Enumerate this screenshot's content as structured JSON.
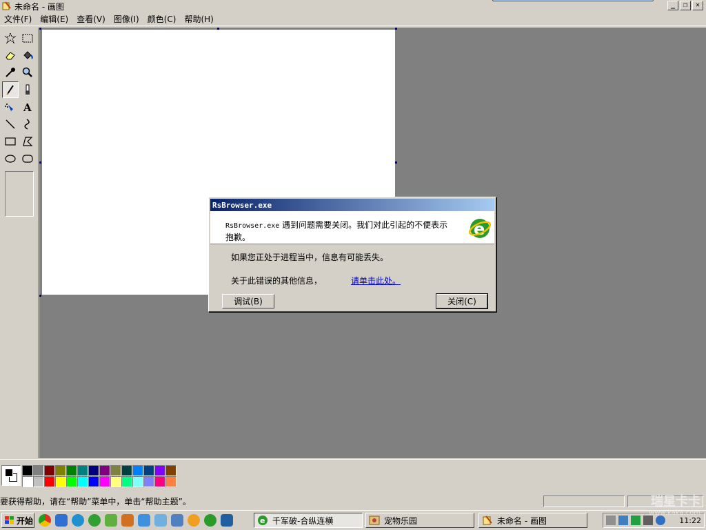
{
  "window": {
    "title": "未命名 - 画图"
  },
  "menu": [
    {
      "label": "文件(F)"
    },
    {
      "label": "编辑(E)"
    },
    {
      "label": "查看(V)"
    },
    {
      "label": "图像(I)"
    },
    {
      "label": "颜色(C)"
    },
    {
      "label": "帮助(H)"
    }
  ],
  "tools": [
    {
      "name": "free-select",
      "icon": "star-select-icon"
    },
    {
      "name": "rect-select",
      "icon": "rect-select-icon"
    },
    {
      "name": "eraser",
      "icon": "eraser-icon"
    },
    {
      "name": "fill",
      "icon": "fill-bucket-icon"
    },
    {
      "name": "pick-color",
      "icon": "eyedropper-icon"
    },
    {
      "name": "magnifier",
      "icon": "magnifier-icon"
    },
    {
      "name": "pencil",
      "icon": "pencil-icon",
      "active": true
    },
    {
      "name": "brush",
      "icon": "brush-icon"
    },
    {
      "name": "airbrush",
      "icon": "airbrush-icon"
    },
    {
      "name": "text",
      "icon": "text-icon"
    },
    {
      "name": "line",
      "icon": "line-icon"
    },
    {
      "name": "curve",
      "icon": "curve-icon"
    },
    {
      "name": "rectangle",
      "icon": "rectangle-icon"
    },
    {
      "name": "polygon",
      "icon": "polygon-icon"
    },
    {
      "name": "ellipse",
      "icon": "ellipse-icon"
    },
    {
      "name": "rounded-rect",
      "icon": "rounded-rect-icon"
    }
  ],
  "palette": {
    "foreground": "#000000",
    "background": "#ffffff",
    "colors": [
      "#000000",
      "#808080",
      "#800000",
      "#808000",
      "#008000",
      "#008080",
      "#000080",
      "#800080",
      "#808040",
      "#004040",
      "#0080ff",
      "#004080",
      "#8000ff",
      "#804000",
      "#ffffff",
      "#c0c0c0",
      "#ff0000",
      "#ffff00",
      "#00ff00",
      "#00ffff",
      "#0000ff",
      "#ff00ff",
      "#ffff80",
      "#00ff80",
      "#80ffff",
      "#8080ff",
      "#ff0080",
      "#ff8040"
    ]
  },
  "status": {
    "text": "要获得帮助，请在“帮助”菜单中，单击“帮助主题”。"
  },
  "taskbar": {
    "start_label": "开始",
    "tasks": [
      {
        "label": "千军破-合纵连横",
        "icon": "ie-icon",
        "pressed": true
      },
      {
        "label": "宠物乐园",
        "icon": "pet-icon",
        "pressed": false
      },
      {
        "label": "未命名 - 画图",
        "icon": "paint-icon",
        "pressed": false
      }
    ],
    "clock": "11:22"
  },
  "watermark": {
    "brand": "瑞星卡卡",
    "url": "www.kaka.com"
  },
  "dialog": {
    "title": "RsBrowser.exe",
    "exe_name": "RsBrowser.exe",
    "message": " 遇到问题需要关闭。我们对此引起的不便表示抱歉。",
    "line1": "如果您正处于进程当中，信息有可能丢失。",
    "line2": "关于此错误的其他信息，",
    "link": "请单击此处。",
    "debug_button": "调试(B)",
    "close_button": "关闭(C)"
  }
}
